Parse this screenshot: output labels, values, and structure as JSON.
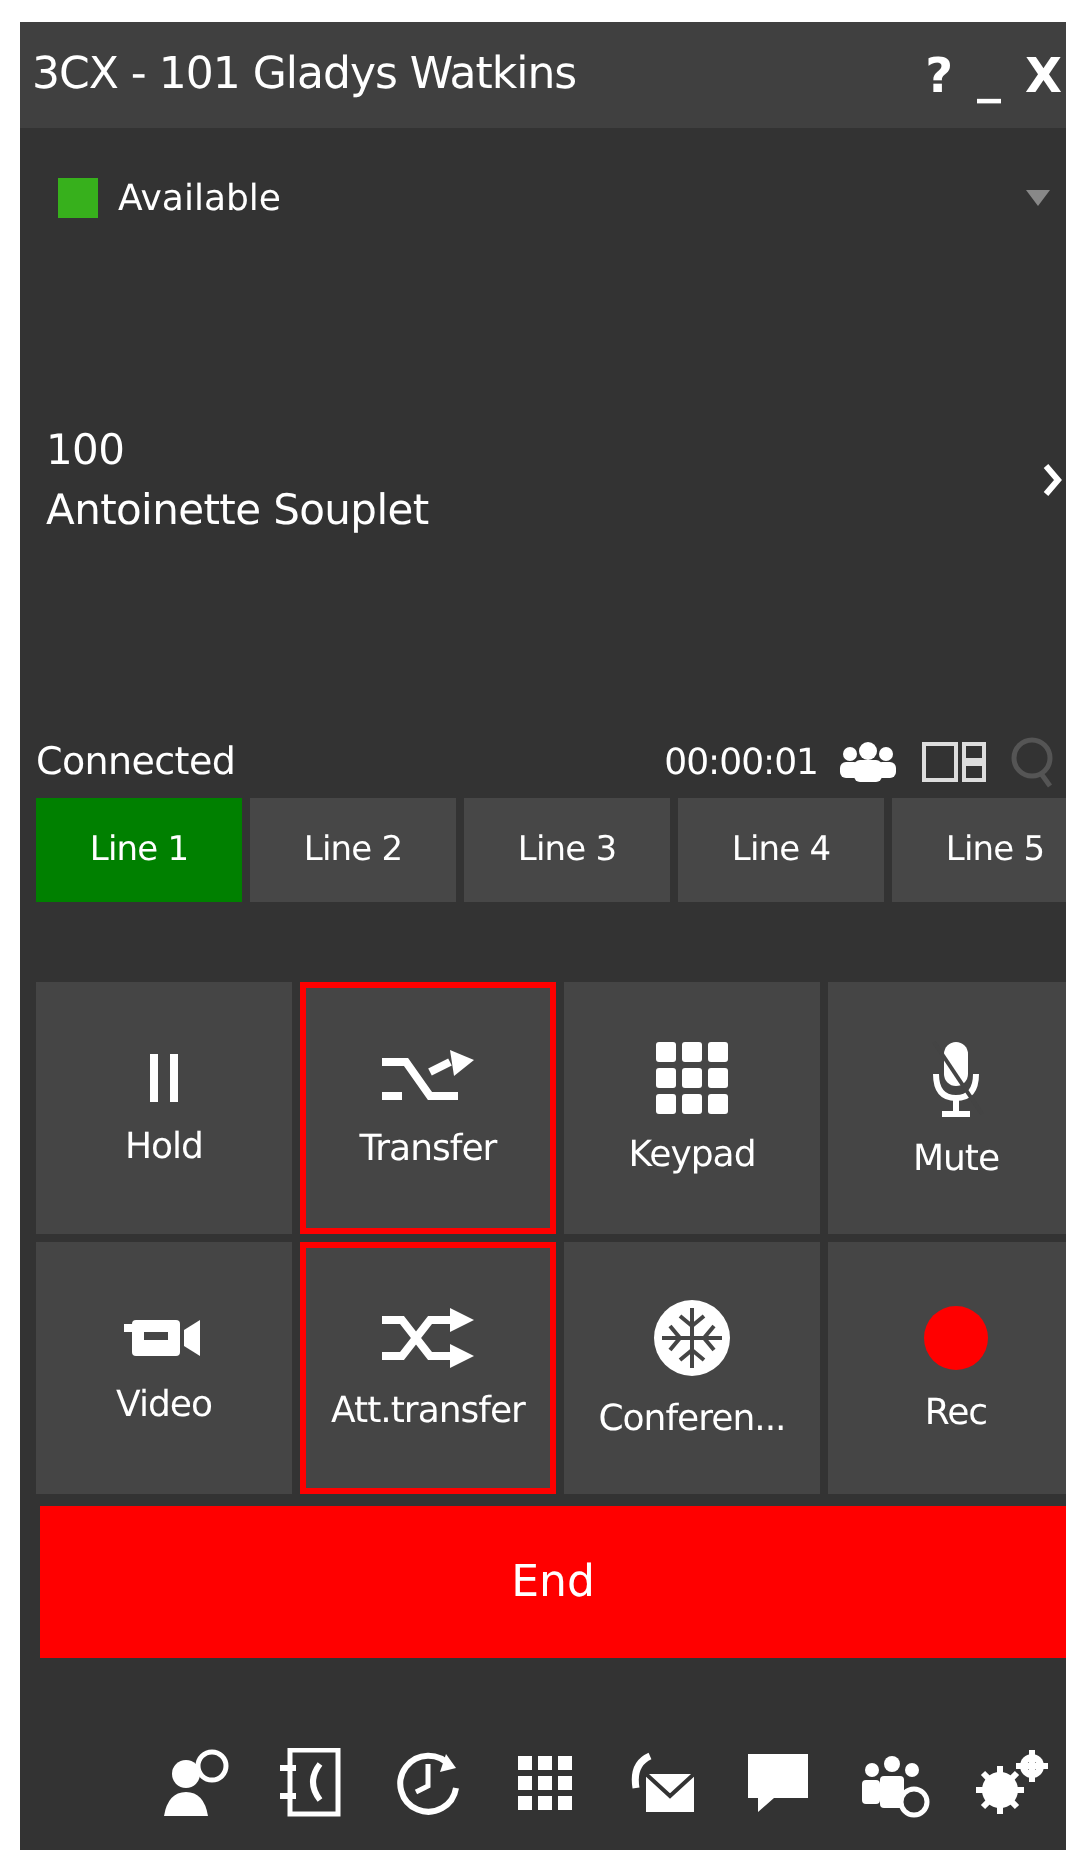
{
  "window": {
    "title": "3CX - 101 Gladys Watkins",
    "title_buttons": [
      "?",
      "_",
      "X"
    ]
  },
  "presence": {
    "label": "Available"
  },
  "caller": {
    "number": "100",
    "name": "Antoinette Souplet"
  },
  "call_status": {
    "label": "Connected",
    "timer": "00:00:01"
  },
  "lines": [
    {
      "label": "Line 1",
      "selected": true
    },
    {
      "label": "Line 2",
      "selected": false
    },
    {
      "label": "Line 3",
      "selected": false
    },
    {
      "label": "Line 4",
      "selected": false
    },
    {
      "label": "Line 5",
      "selected": false
    }
  ],
  "actions": [
    {
      "kind": "hold",
      "label": "Hold",
      "highlighted": false
    },
    {
      "kind": "transfer",
      "label": "Transfer",
      "highlighted": true
    },
    {
      "kind": "keypad",
      "label": "Keypad",
      "highlighted": false
    },
    {
      "kind": "mute",
      "label": "Mute",
      "highlighted": false
    },
    {
      "kind": "video",
      "label": "Video",
      "highlighted": false
    },
    {
      "kind": "att_transfer",
      "label": "Att.transfer",
      "highlighted": true
    },
    {
      "kind": "conference",
      "label": "Conferen...",
      "highlighted": false
    },
    {
      "kind": "rec",
      "label": "Rec",
      "highlighted": false
    }
  ],
  "end_button": {
    "label": "End"
  }
}
